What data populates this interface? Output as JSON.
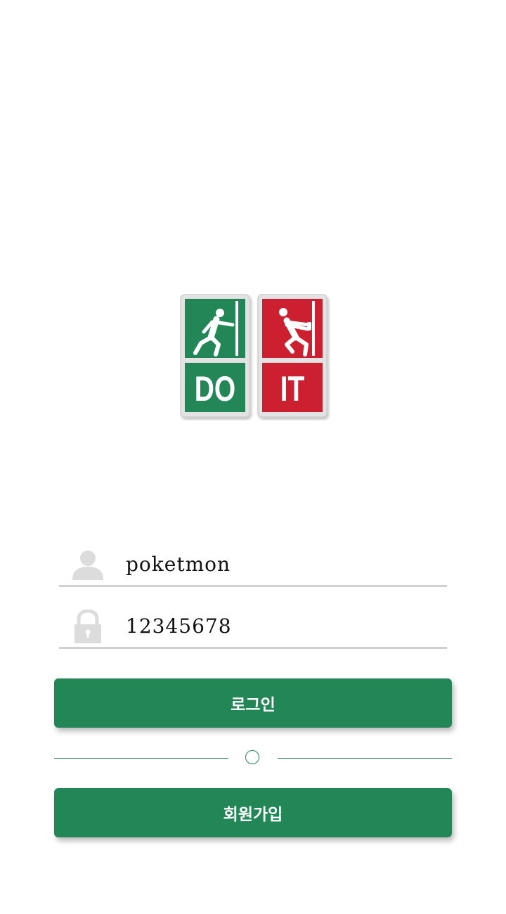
{
  "logo": {
    "top_left_text": "",
    "bottom_left_text": "DO",
    "bottom_right_text": "IT",
    "green_color": "#238656",
    "red_color": "#cc1f30"
  },
  "login_form": {
    "username": {
      "icon": "user-icon",
      "value": "poketmon"
    },
    "password": {
      "icon": "lock-icon",
      "value": "12345678"
    },
    "login_label": "로그인",
    "signup_label": "회원가입"
  },
  "colors": {
    "primary": "#238656",
    "field_underline": "#d0d0d0",
    "icon_gray": "#dcdcdc"
  }
}
